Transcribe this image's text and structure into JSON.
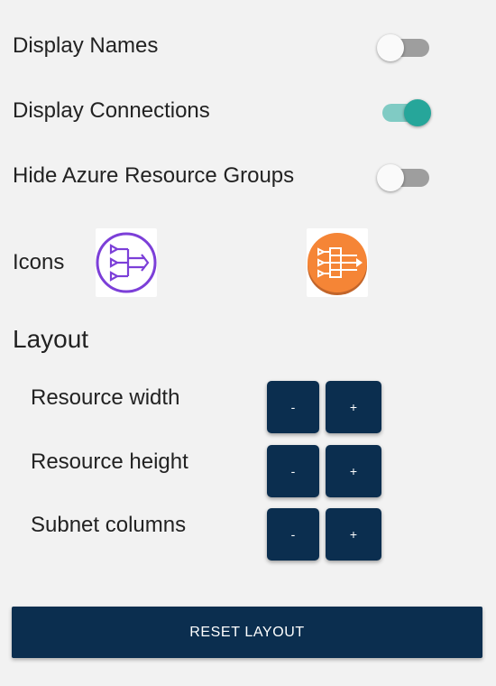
{
  "settings": {
    "toggles": [
      {
        "label": "Display Names",
        "on": false
      },
      {
        "label": "Display Connections",
        "on": true
      },
      {
        "label": "Hide Azure Resource Groups",
        "on": false
      }
    ],
    "icons_label": "Icons",
    "icon_options": [
      {
        "name": "azure-load-balancer-icon",
        "color": "#7c3fd8"
      },
      {
        "name": "aws-elastic-load-balancer-icon",
        "color": "#f58536"
      }
    ]
  },
  "layout": {
    "heading": "Layout",
    "rows": [
      {
        "label": "Resource width",
        "minus": "-",
        "plus": "+"
      },
      {
        "label": "Resource height",
        "minus": "-",
        "plus": "+"
      },
      {
        "label": "Subnet columns",
        "minus": "-",
        "plus": "+"
      }
    ],
    "reset_label": "RESET LAYOUT"
  },
  "colors": {
    "background": "#f2f2f2",
    "button": "#0b2e4f",
    "toggle_on": "#26a69a",
    "toggle_on_track": "#80cbc4",
    "toggle_off_track": "#9e9e9e"
  }
}
